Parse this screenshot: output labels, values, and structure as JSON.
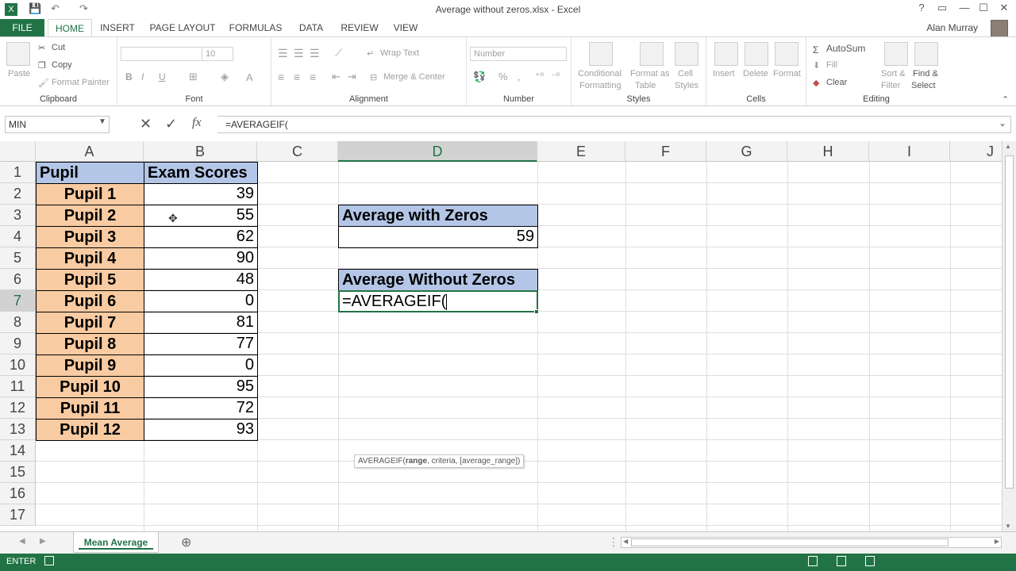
{
  "window": {
    "title": "Average without zeros.xlsx - Excel",
    "buttons": [
      "?",
      "▭",
      "—",
      "☐",
      "✕"
    ]
  },
  "ribbon_tabs": [
    "FILE",
    "HOME",
    "INSERT",
    "PAGE LAYOUT",
    "FORMULAS",
    "DATA",
    "REVIEW",
    "VIEW"
  ],
  "user": {
    "name": "Alan Murray"
  },
  "ribbon": {
    "clipboard": {
      "label": "Clipboard",
      "paste": "Paste",
      "cut": "Cut",
      "copy": "Copy",
      "format_painter": "Format Painter"
    },
    "font": {
      "label": "Font",
      "size": "10",
      "bold": "B",
      "italic": "I",
      "underline": "U",
      "font_color": "A"
    },
    "alignment": {
      "label": "Alignment",
      "wrap_text": "Wrap Text",
      "merge_center": "Merge & Center"
    },
    "number": {
      "label": "Number",
      "format": "Number",
      "percent": "%",
      "comma": ","
    },
    "styles": {
      "label": "Styles",
      "conditional": "Conditional",
      "conditional2": "Formatting",
      "format_as": "Format as",
      "format_as2": "Table",
      "cell_styles": "Cell",
      "cell_styles2": "Styles"
    },
    "cells": {
      "label": "Cells",
      "insert": "Insert",
      "delete": "Delete",
      "format": "Format"
    },
    "editing": {
      "label": "Editing",
      "autosum": "AutoSum",
      "fill": "Fill",
      "clear": "Clear",
      "sort": "Sort &",
      "sort2": "Filter",
      "find": "Find &",
      "find2": "Select"
    }
  },
  "formula_bar": {
    "name_box": "MIN",
    "formula": "=AVERAGEIF(",
    "fx": "fx"
  },
  "columns": [
    "A",
    "B",
    "C",
    "D",
    "E",
    "F",
    "G",
    "H",
    "I",
    "J"
  ],
  "rows": [
    "1",
    "2",
    "3",
    "4",
    "5",
    "6",
    "7",
    "8",
    "9",
    "10",
    "11",
    "12",
    "13",
    "14",
    "15",
    "16",
    "17"
  ],
  "table": {
    "header_a": "Pupil",
    "header_b": "Exam Scores",
    "pupils": [
      "Pupil 1",
      "Pupil 2",
      "Pupil 3",
      "Pupil 4",
      "Pupil 5",
      "Pupil 6",
      "Pupil 7",
      "Pupil 8",
      "Pupil 9",
      "Pupil 10",
      "Pupil 11",
      "Pupil 12"
    ],
    "scores": [
      "39",
      "55",
      "62",
      "90",
      "48",
      "0",
      "81",
      "77",
      "0",
      "95",
      "72",
      "93"
    ]
  },
  "summary": {
    "with_zeros_label": "Average with Zeros",
    "with_zeros_value": "59",
    "without_zeros_label": "Average Without Zeros",
    "editing_value": "=AVERAGEIF(",
    "tooltip_fn": "AVERAGEIF(",
    "tooltip_arg1": "range",
    "tooltip_rest": ", criteria, [average_range])"
  },
  "sheet": {
    "tab": "Mean Average",
    "add": "⊕"
  },
  "status": {
    "mode": "ENTER"
  },
  "colors": {
    "excel_green": "#217346",
    "pupil_fill": "#f8cba2",
    "header_fill": "#b4c6e7"
  }
}
